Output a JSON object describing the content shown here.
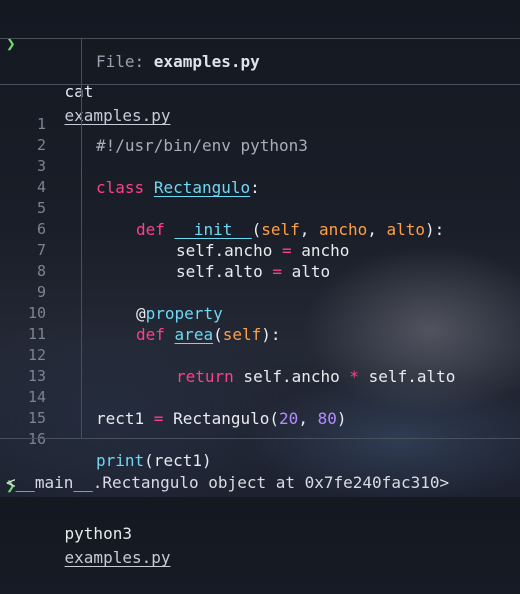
{
  "first_prompt": {
    "symbol": "❯",
    "command": "cat",
    "arg": "examples.py"
  },
  "header": {
    "label": "File: ",
    "filename": "examples.py"
  },
  "code": {
    "line_numbers": [
      "1",
      "2",
      "3",
      "4",
      "5",
      "6",
      "7",
      "8",
      "9",
      "10",
      "11",
      "12",
      "13",
      "14",
      "15",
      "16"
    ],
    "l1": "#!/usr/bin/env python3",
    "l3": {
      "kw": "class",
      "name": "Rectangulo",
      "colon": ":"
    },
    "l5": {
      "kw": "def",
      "fn": "__init__",
      "open": "(",
      "p1": "self",
      "c1": ", ",
      "p2": "ancho",
      "c2": ", ",
      "p3": "alto",
      "close": "):"
    },
    "l6": {
      "a": "self.ancho",
      "op": " = ",
      "b": "ancho"
    },
    "l7": {
      "a": "self.alto",
      "op": " = ",
      "b": "alto"
    },
    "l9": {
      "at": "@",
      "name": "property"
    },
    "l10": {
      "kw": "def",
      "fn": "area",
      "open": "(",
      "p1": "self",
      "close": "):"
    },
    "l12": {
      "kw": "return",
      "a": " self.ancho ",
      "op": "*",
      "b": " self.alto"
    },
    "l14": {
      "a": "rect1",
      "op": " = ",
      "cls": "Rectangulo(",
      "n1": "20",
      "c": ", ",
      "n2": "80",
      "close": ")"
    },
    "l16": {
      "fn": "print",
      "rest": "(rect1)"
    }
  },
  "second_prompt": {
    "symbol": "❯",
    "command": "python3",
    "arg": "examples.py"
  },
  "output": "<__main__.Rectangulo object at 0x7fe240fac310>"
}
